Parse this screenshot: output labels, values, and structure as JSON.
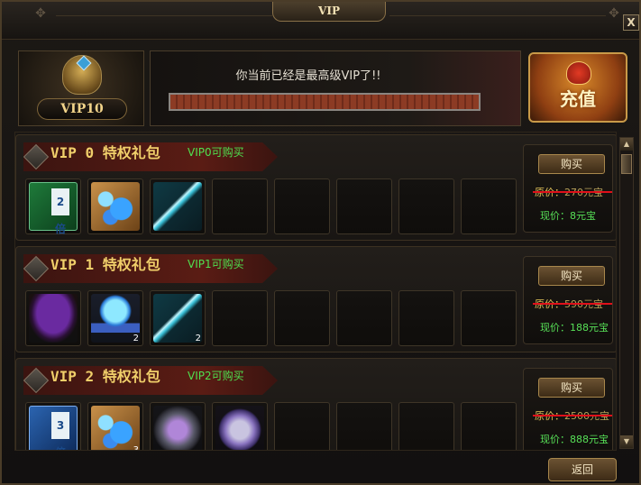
{
  "window": {
    "title": "VIP",
    "close_label": "X"
  },
  "header": {
    "vip_level": "VIP10",
    "status_text": "你当前已经是最高级VIP了!!",
    "progress_fraction": 1.0,
    "recharge_label": "充值"
  },
  "rows": [
    {
      "title": "VIP 0 特权礼包",
      "subtitle": "VIP0可购买",
      "items": [
        {
          "icon": "double-exp-book-icon",
          "glyph": "2倍",
          "count": ""
        },
        {
          "icon": "blue-orbs-icon",
          "count": ""
        },
        {
          "icon": "sword-icon",
          "count": ""
        }
      ],
      "buy_label": "购买",
      "original_label": "原价：",
      "original_value": "270元宝",
      "current_label": "现价：",
      "current_value": "8元宝"
    },
    {
      "title": "VIP 1 特权礼包",
      "subtitle": "VIP1可购买",
      "items": [
        {
          "icon": "purple-cloak-icon",
          "count": ""
        },
        {
          "icon": "crystal-ball-icon",
          "count": "2"
        },
        {
          "icon": "sword-icon",
          "count": "2"
        }
      ],
      "buy_label": "购买",
      "original_label": "原价：",
      "original_value": "590元宝",
      "current_label": "现价：",
      "current_value": "188元宝"
    },
    {
      "title": "VIP 2 特权礼包",
      "subtitle": "VIP2可购买",
      "items": [
        {
          "icon": "triple-exp-book-icon",
          "glyph": "3倍",
          "count": ""
        },
        {
          "icon": "blue-orbs-icon",
          "count": "3"
        },
        {
          "icon": "enhance-stone-icon",
          "count": ""
        },
        {
          "icon": "silver-coin-icon",
          "count": ""
        }
      ],
      "buy_label": "购买",
      "original_label": "原价：",
      "original_value": "2500元宝",
      "current_label": "现价：",
      "current_value": "888元宝"
    }
  ],
  "footer": {
    "back_label": "返回"
  },
  "colors": {
    "accent_gold": "#f0cf6a",
    "green_text": "#4fe04f",
    "strike_red": "#e0101a"
  }
}
